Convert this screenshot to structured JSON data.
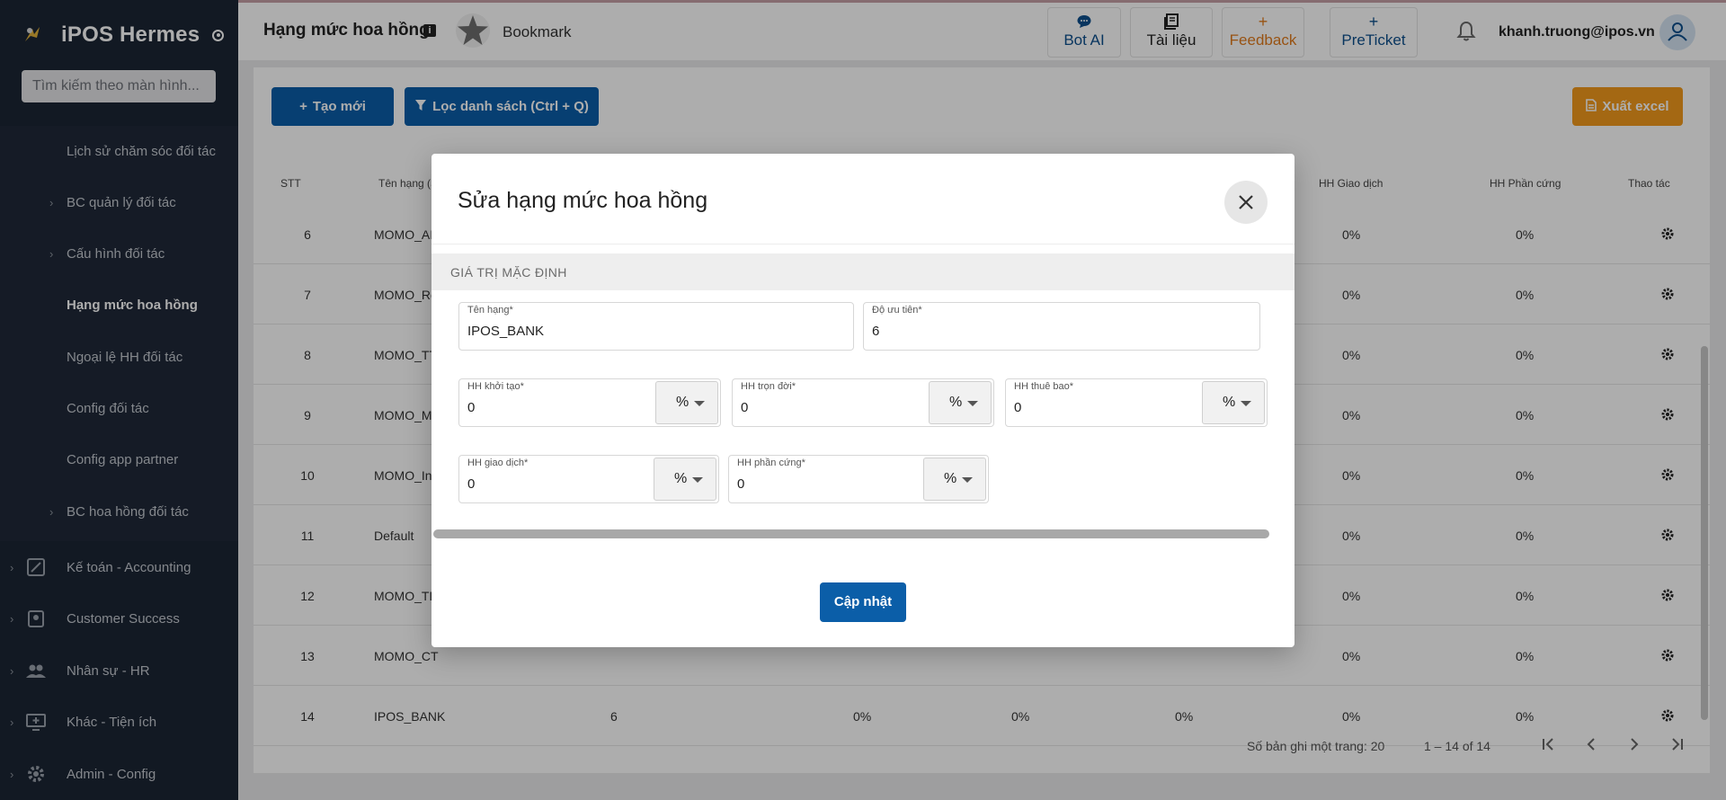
{
  "app": {
    "name": "iPOS Hermes"
  },
  "sidebar": {
    "search_placeholder": "Tìm kiếm theo màn hình...",
    "sub_items": [
      {
        "label": "Lịch sử chăm sóc đối tác",
        "has_chevron": false
      },
      {
        "label": "BC quản lý đối tác",
        "has_chevron": true
      },
      {
        "label": "Cấu hình đối tác",
        "has_chevron": true
      },
      {
        "label": "Hạng mức hoa hồng",
        "has_chevron": false,
        "active": true
      },
      {
        "label": "Ngoại lệ HH đối tác",
        "has_chevron": false
      },
      {
        "label": "Config đối tác",
        "has_chevron": false
      },
      {
        "label": "Config app partner",
        "has_chevron": false
      },
      {
        "label": "BC hoa hồng đối tác",
        "has_chevron": true
      }
    ],
    "main_items": [
      {
        "label": "Kế toán - Accounting",
        "icon": "accounting-icon"
      },
      {
        "label": "Customer Success",
        "icon": "customer-success-icon"
      },
      {
        "label": "Nhân sự - HR",
        "icon": "people-icon"
      },
      {
        "label": "Khác - Tiện ích",
        "icon": "monitor-plus-icon"
      },
      {
        "label": "Admin - Config",
        "icon": "gear-icon"
      }
    ]
  },
  "header": {
    "title": "Hạng mức hoa hồng",
    "bookmark_label": "Bookmark",
    "buttons": [
      {
        "label": "Bot AI",
        "icon": "chat-icon"
      },
      {
        "label": "Tài liệu",
        "icon": "document-icon"
      },
      {
        "label": "Feedback",
        "icon": "plus-icon"
      },
      {
        "label": "PreTicket",
        "icon": "plus-icon"
      }
    ],
    "user_email": "khanh.truong@ipos.vn"
  },
  "toolbar": {
    "create_label": "Tạo mới",
    "filter_label": "Lọc danh sách (Ctrl + Q)",
    "export_label": "Xuất excel"
  },
  "table": {
    "columns": {
      "stt": "STT",
      "name": "Tên hạng (S",
      "hh_giao_dich": "HH Giao dịch",
      "hh_phan_cung": "HH Phần cứng",
      "actions": "Thao tác"
    },
    "rows": [
      {
        "stt": "6",
        "name": "MOMO_AI",
        "giao_dich": "0%",
        "phan_cung": "0%"
      },
      {
        "stt": "7",
        "name": "MOMO_Re",
        "giao_dich": "0%",
        "phan_cung": "0%"
      },
      {
        "stt": "8",
        "name": "MOMO_TT",
        "giao_dich": "0%",
        "phan_cung": "0%"
      },
      {
        "stt": "9",
        "name": "MOMO_M",
        "giao_dich": "0%",
        "phan_cung": "0%"
      },
      {
        "stt": "10",
        "name": "MOMO_In",
        "giao_dich": "0%",
        "phan_cung": "0%"
      },
      {
        "stt": "11",
        "name": "Default",
        "giao_dich": "0%",
        "phan_cung": "0%"
      },
      {
        "stt": "12",
        "name": "MOMO_TL",
        "giao_dich": "0%",
        "phan_cung": "0%"
      },
      {
        "stt": "13",
        "name": "MOMO_CT",
        "giao_dich": "0%",
        "phan_cung": "0%"
      },
      {
        "stt": "14",
        "name": "IPOS_BANK",
        "priority": "6",
        "c1": "0%",
        "c2": "0%",
        "c3": "0%",
        "giao_dich": "0%",
        "phan_cung": "0%"
      }
    ],
    "page_size_label": "Số bản ghi một trang: 20",
    "range_label": "1 – 14 of 14"
  },
  "modal": {
    "title": "Sửa hạng mức hoa hồng",
    "section": "GIÁ TRỊ MẶC ĐỊNH",
    "fields": {
      "name": {
        "label": "Tên hạng*",
        "value": "IPOS_BANK"
      },
      "priority": {
        "label": "Độ ưu tiên*",
        "value": "6"
      },
      "hh_khoi_tao": {
        "label": "HH khởi tạo*",
        "value": "0",
        "unit": "%"
      },
      "hh_tron_doi": {
        "label": "HH trọn đời*",
        "value": "0",
        "unit": "%"
      },
      "hh_thue_bao": {
        "label": "HH thuê bao*",
        "value": "0",
        "unit": "%"
      },
      "hh_giao_dich": {
        "label": "HH giao dịch*",
        "value": "0",
        "unit": "%"
      },
      "hh_phan_cung": {
        "label": "HH phần cứng*",
        "value": "0",
        "unit": "%"
      }
    },
    "submit_label": "Cập nhật"
  }
}
